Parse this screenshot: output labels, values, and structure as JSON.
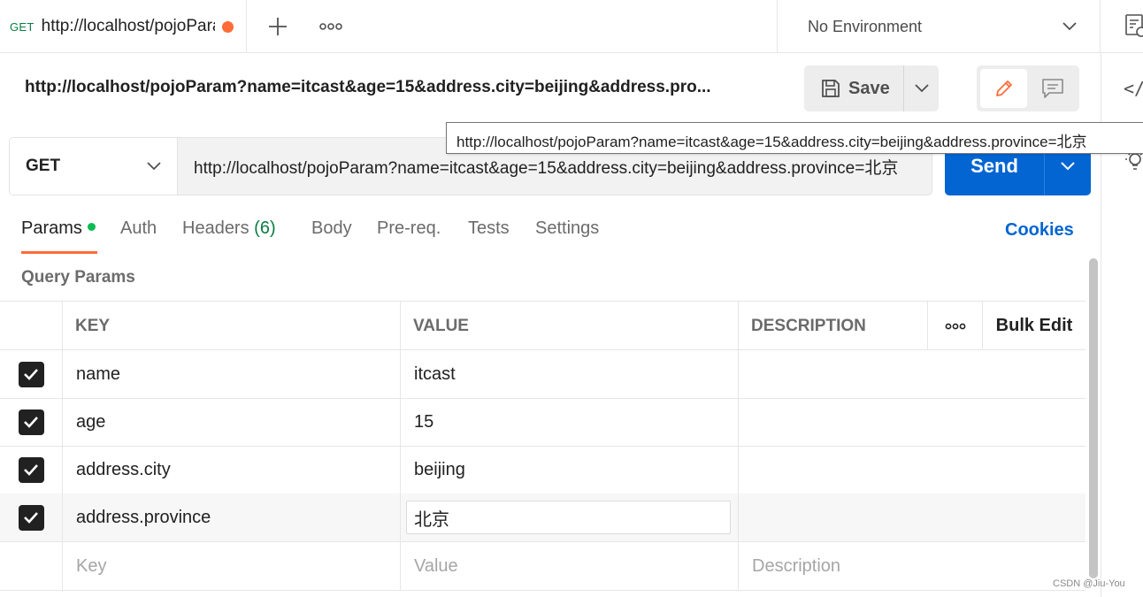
{
  "tab": {
    "method": "GET",
    "title": "http://localhost/pojoParam",
    "unsaved": true
  },
  "environment": {
    "selected": "No Environment"
  },
  "request": {
    "title": "http://localhost/pojoParam?name=itcast&age=15&address.city=beijing&address.pro...",
    "method": "GET",
    "url": "http://localhost/pojoParam?name=itcast&age=15&address.city=beijing&address.province=北京",
    "tooltip": "http://localhost/pojoParam?name=itcast&age=15&address.city=beijing&address.province=北京"
  },
  "toolbar": {
    "save_label": "Save",
    "send_label": "Send",
    "code_icon_text": "</>"
  },
  "request_tabs": [
    {
      "label": "Params",
      "active": true,
      "has_dot": true
    },
    {
      "label": "Auth"
    },
    {
      "label": "Headers",
      "count": "(6)"
    },
    {
      "label": "Body"
    },
    {
      "label": "Pre-req."
    },
    {
      "label": "Tests"
    },
    {
      "label": "Settings"
    }
  ],
  "cookies_label": "Cookies",
  "query_params": {
    "section_title": "Query Params",
    "columns": {
      "key": "KEY",
      "value": "VALUE",
      "description": "DESCRIPTION"
    },
    "bulk_edit_label": "Bulk Edit",
    "rows": [
      {
        "checked": true,
        "key": "name",
        "value": "itcast",
        "description": ""
      },
      {
        "checked": true,
        "key": "age",
        "value": "15",
        "description": ""
      },
      {
        "checked": true,
        "key": "address.city",
        "value": "beijing",
        "description": ""
      },
      {
        "checked": true,
        "key": "address.province",
        "value": "北京",
        "description": ""
      }
    ],
    "placeholders": {
      "key": "Key",
      "value": "Value",
      "description": "Description"
    }
  },
  "watermark": "CSDN @Jiu-You",
  "colors": {
    "accent_orange": "#ff6c37",
    "send_blue": "#0265d2",
    "method_green": "#0a7d42",
    "params_dot_green": "#0cbb52"
  }
}
